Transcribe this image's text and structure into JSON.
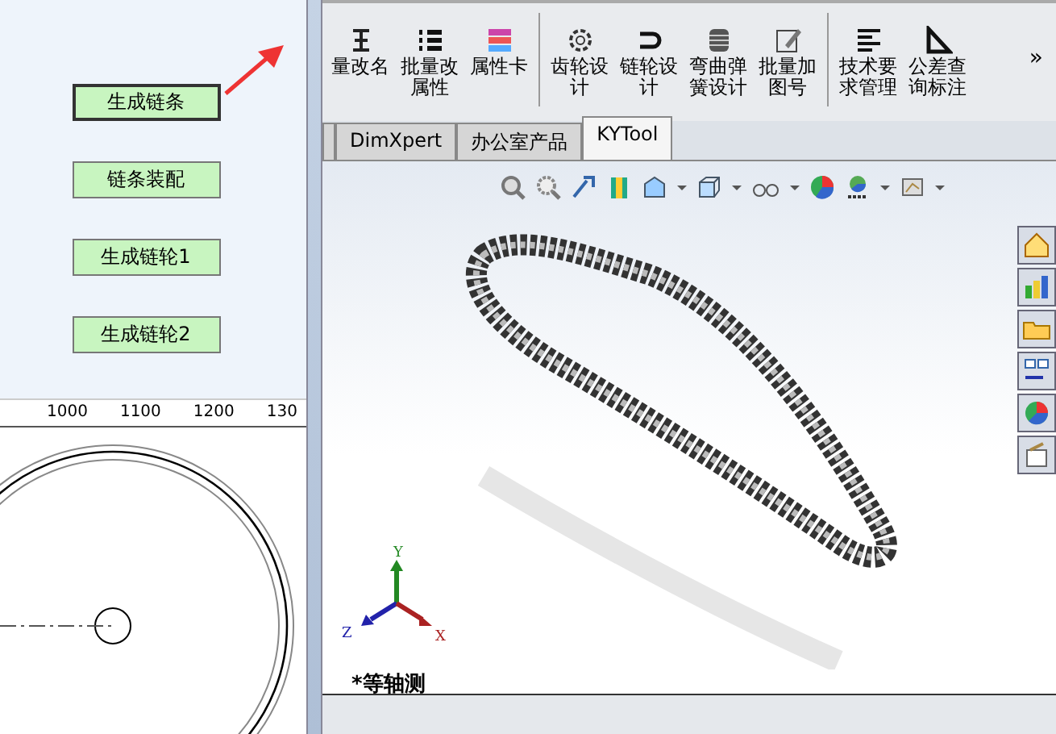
{
  "left_panel": {
    "buttons": [
      {
        "label": "生成链条",
        "selected": true
      },
      {
        "label": "链条装配",
        "selected": false
      },
      {
        "label": "生成链轮1",
        "selected": false
      },
      {
        "label": "生成链轮2",
        "selected": false
      }
    ],
    "ruler": {
      "labels": [
        "1000",
        "1100",
        "1200",
        "130"
      ]
    }
  },
  "toolbar": {
    "groups": [
      [
        {
          "label": "量改名"
        },
        {
          "label": "批量改属性"
        },
        {
          "label": "属性卡"
        }
      ],
      [
        {
          "label": "齿轮设计"
        },
        {
          "label": "链轮设计"
        },
        {
          "label": "弯曲弹簧设计"
        },
        {
          "label": "批量加图号"
        }
      ],
      [
        {
          "label": "技术要求管理"
        },
        {
          "label": "公差查询标注"
        }
      ]
    ],
    "overflow": "»"
  },
  "tabs": [
    {
      "label": "DimXpert",
      "selected": false
    },
    {
      "label": "办公室产品",
      "selected": false
    },
    {
      "label": "KYTool",
      "selected": true
    }
  ],
  "viewport": {
    "axes": [
      "Y",
      "Z",
      "X"
    ],
    "view_label": "*等轴测"
  }
}
